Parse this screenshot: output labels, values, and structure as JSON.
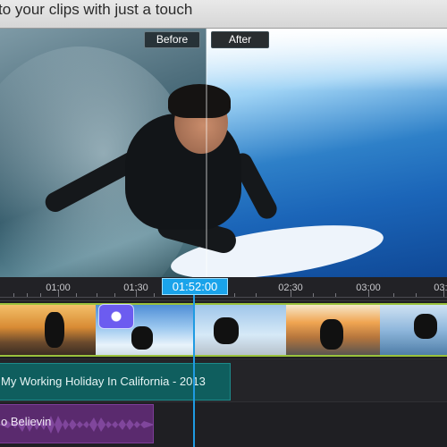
{
  "header": {
    "title": "to your clips with just a touch"
  },
  "preview": {
    "before_label": "Before",
    "after_label": "After"
  },
  "timeline": {
    "ruler_labels": [
      "01:00",
      "01:30",
      "02:30",
      "03:00",
      "03:3"
    ],
    "playhead_time": "01:52:00"
  },
  "tracks": {
    "title_clip_label": "My Working Holiday In California - 2013",
    "audio_clip_label": "o Believin"
  },
  "colors": {
    "accent": "#1aa3ea",
    "clip_border": "#9ac23c",
    "title_clip": "#0f5e5e",
    "audio_clip": "#5a2a6e"
  }
}
